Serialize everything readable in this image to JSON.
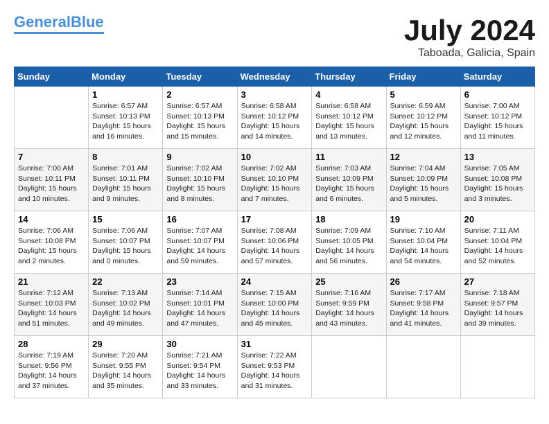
{
  "header": {
    "logo_line1": "General",
    "logo_line2": "Blue",
    "month": "July 2024",
    "location": "Taboada, Galicia, Spain"
  },
  "days_of_week": [
    "Sunday",
    "Monday",
    "Tuesday",
    "Wednesday",
    "Thursday",
    "Friday",
    "Saturday"
  ],
  "weeks": [
    [
      {
        "day": "",
        "info": ""
      },
      {
        "day": "1",
        "info": "Sunrise: 6:57 AM\nSunset: 10:13 PM\nDaylight: 15 hours\nand 16 minutes."
      },
      {
        "day": "2",
        "info": "Sunrise: 6:57 AM\nSunset: 10:13 PM\nDaylight: 15 hours\nand 15 minutes."
      },
      {
        "day": "3",
        "info": "Sunrise: 6:58 AM\nSunset: 10:12 PM\nDaylight: 15 hours\nand 14 minutes."
      },
      {
        "day": "4",
        "info": "Sunrise: 6:58 AM\nSunset: 10:12 PM\nDaylight: 15 hours\nand 13 minutes."
      },
      {
        "day": "5",
        "info": "Sunrise: 6:59 AM\nSunset: 10:12 PM\nDaylight: 15 hours\nand 12 minutes."
      },
      {
        "day": "6",
        "info": "Sunrise: 7:00 AM\nSunset: 10:12 PM\nDaylight: 15 hours\nand 11 minutes."
      }
    ],
    [
      {
        "day": "7",
        "info": "Sunrise: 7:00 AM\nSunset: 10:11 PM\nDaylight: 15 hours\nand 10 minutes."
      },
      {
        "day": "8",
        "info": "Sunrise: 7:01 AM\nSunset: 10:11 PM\nDaylight: 15 hours\nand 9 minutes."
      },
      {
        "day": "9",
        "info": "Sunrise: 7:02 AM\nSunset: 10:10 PM\nDaylight: 15 hours\nand 8 minutes."
      },
      {
        "day": "10",
        "info": "Sunrise: 7:02 AM\nSunset: 10:10 PM\nDaylight: 15 hours\nand 7 minutes."
      },
      {
        "day": "11",
        "info": "Sunrise: 7:03 AM\nSunset: 10:09 PM\nDaylight: 15 hours\nand 6 minutes."
      },
      {
        "day": "12",
        "info": "Sunrise: 7:04 AM\nSunset: 10:09 PM\nDaylight: 15 hours\nand 5 minutes."
      },
      {
        "day": "13",
        "info": "Sunrise: 7:05 AM\nSunset: 10:08 PM\nDaylight: 15 hours\nand 3 minutes."
      }
    ],
    [
      {
        "day": "14",
        "info": "Sunrise: 7:06 AM\nSunset: 10:08 PM\nDaylight: 15 hours\nand 2 minutes."
      },
      {
        "day": "15",
        "info": "Sunrise: 7:06 AM\nSunset: 10:07 PM\nDaylight: 15 hours\nand 0 minutes."
      },
      {
        "day": "16",
        "info": "Sunrise: 7:07 AM\nSunset: 10:07 PM\nDaylight: 14 hours\nand 59 minutes."
      },
      {
        "day": "17",
        "info": "Sunrise: 7:08 AM\nSunset: 10:06 PM\nDaylight: 14 hours\nand 57 minutes."
      },
      {
        "day": "18",
        "info": "Sunrise: 7:09 AM\nSunset: 10:05 PM\nDaylight: 14 hours\nand 56 minutes."
      },
      {
        "day": "19",
        "info": "Sunrise: 7:10 AM\nSunset: 10:04 PM\nDaylight: 14 hours\nand 54 minutes."
      },
      {
        "day": "20",
        "info": "Sunrise: 7:11 AM\nSunset: 10:04 PM\nDaylight: 14 hours\nand 52 minutes."
      }
    ],
    [
      {
        "day": "21",
        "info": "Sunrise: 7:12 AM\nSunset: 10:03 PM\nDaylight: 14 hours\nand 51 minutes."
      },
      {
        "day": "22",
        "info": "Sunrise: 7:13 AM\nSunset: 10:02 PM\nDaylight: 14 hours\nand 49 minutes."
      },
      {
        "day": "23",
        "info": "Sunrise: 7:14 AM\nSunset: 10:01 PM\nDaylight: 14 hours\nand 47 minutes."
      },
      {
        "day": "24",
        "info": "Sunrise: 7:15 AM\nSunset: 10:00 PM\nDaylight: 14 hours\nand 45 minutes."
      },
      {
        "day": "25",
        "info": "Sunrise: 7:16 AM\nSunset: 9:59 PM\nDaylight: 14 hours\nand 43 minutes."
      },
      {
        "day": "26",
        "info": "Sunrise: 7:17 AM\nSunset: 9:58 PM\nDaylight: 14 hours\nand 41 minutes."
      },
      {
        "day": "27",
        "info": "Sunrise: 7:18 AM\nSunset: 9:57 PM\nDaylight: 14 hours\nand 39 minutes."
      }
    ],
    [
      {
        "day": "28",
        "info": "Sunrise: 7:19 AM\nSunset: 9:56 PM\nDaylight: 14 hours\nand 37 minutes."
      },
      {
        "day": "29",
        "info": "Sunrise: 7:20 AM\nSunset: 9:55 PM\nDaylight: 14 hours\nand 35 minutes."
      },
      {
        "day": "30",
        "info": "Sunrise: 7:21 AM\nSunset: 9:54 PM\nDaylight: 14 hours\nand 33 minutes."
      },
      {
        "day": "31",
        "info": "Sunrise: 7:22 AM\nSunset: 9:53 PM\nDaylight: 14 hours\nand 31 minutes."
      },
      {
        "day": "",
        "info": ""
      },
      {
        "day": "",
        "info": ""
      },
      {
        "day": "",
        "info": ""
      }
    ]
  ]
}
